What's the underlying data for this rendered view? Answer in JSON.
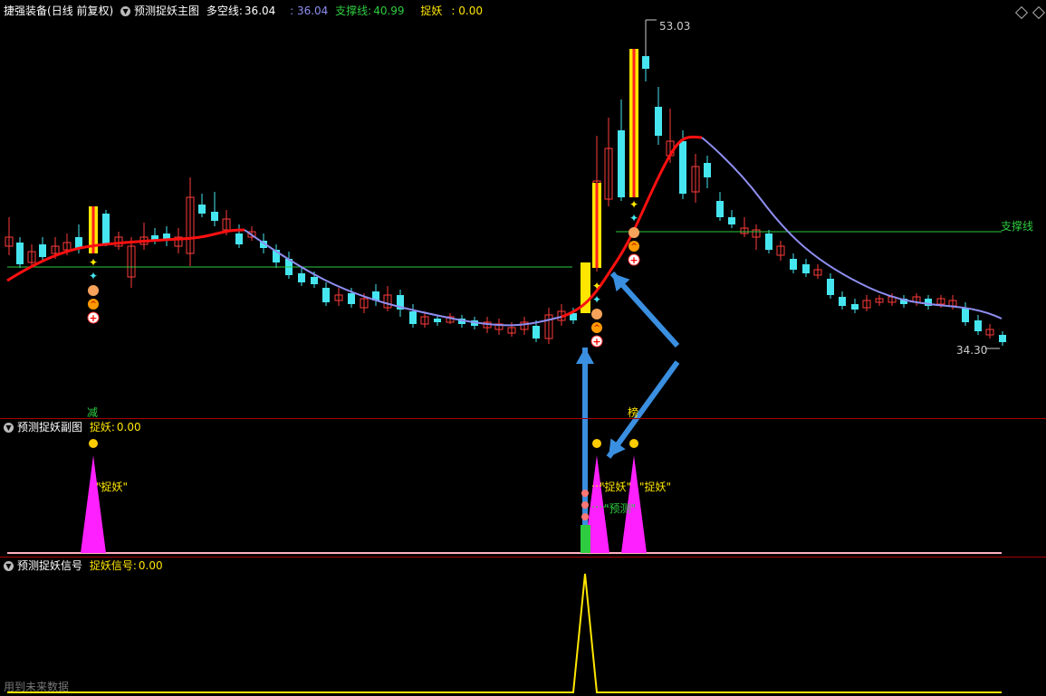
{
  "header_main": {
    "indicator_name": "捷强装备",
    "period": "(日线 前复权)",
    "formula_name": "预测捉妖主图",
    "duokong_label": "多空线:",
    "duokong_value": "36.04",
    "second_value": ": 36.04",
    "support_label": "支撑线:",
    "support_value": "40.99",
    "zhuoyao_label": "捉妖",
    "zhuoyao_value": ": 0.00"
  },
  "main_chart": {
    "high_label": "53.03",
    "low_label": "34.30",
    "support_line_label": "支撑线",
    "colors": {
      "up": "#ff3b3b",
      "down": "#46e6f0",
      "ma_red": "#ff1010",
      "ma_blue": "#8e8ef0",
      "support": "#2ecc40",
      "signal": "#ffe600"
    }
  },
  "header_sub1": {
    "formula_name": "预测捉妖副图",
    "label": "捉妖:",
    "value": "0.00",
    "tag_left": "减",
    "tag_right": "榜"
  },
  "sub1_chart": {
    "annot_1": "\"捉妖\"",
    "annot_2": "\"捉妖\"",
    "annot_3": "\"捉妖\"",
    "annot_4": "\"预测\""
  },
  "header_sub2": {
    "formula_name": "预测捉妖信号",
    "label": "捉妖信号:",
    "value": "0.00"
  },
  "footer": {
    "text": "用到未来数据"
  }
}
